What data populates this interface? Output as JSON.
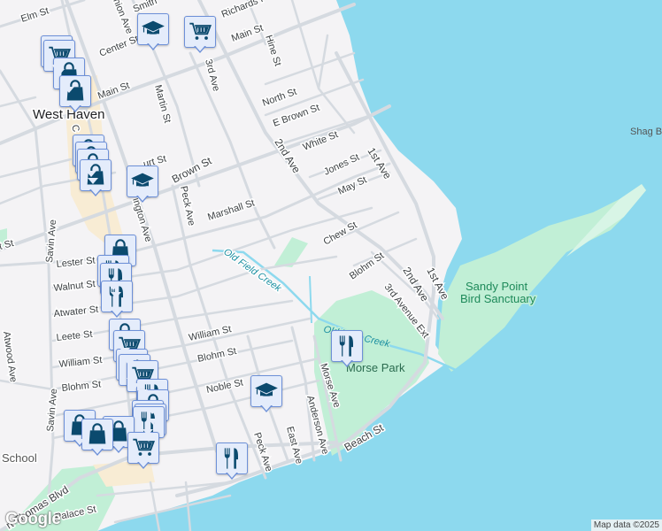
{
  "map": {
    "town": "West Haven",
    "park_morse": "Morse Park",
    "park_sandy_1": "Sandy Point",
    "park_sandy_2": "Bird Sanctuary",
    "shag": "Shag B",
    "creek1": "Old Field Creek",
    "creek2": "Old Field Creek",
    "school": "School",
    "streets": {
      "elm": "Elm St",
      "main1": "Main St",
      "main2": "Main St",
      "center": "Center St",
      "smith": "Smith",
      "richards": "Richards P",
      "union": "nion Ave",
      "hine": "Hine St",
      "north": "North St",
      "ebrown": "E Brown St",
      "white": "White St",
      "jones": "Jones St",
      "may": "May St",
      "chew": "Chew St",
      "blohm_e": "Blohm St",
      "second1": "2nd Ave",
      "second2": "2nd Ave",
      "first": "1st Ave",
      "third": "3rd Ave",
      "third_ext": "3rd Avenue Ext",
      "martin": "Martin St",
      "brown": "Brown St",
      "court": "urt St",
      "washington": "ington Ave",
      "peck1": "Peck Ave",
      "marshall": "Marshall St",
      "savin1": "Savin Ave",
      "savin2": "Savin Ave",
      "west": "t St",
      "lester": "Lester St",
      "walnut": "Walnut St",
      "atwater": "Atwater St",
      "leete": "Leete St",
      "william1": "William St",
      "william2": "William St",
      "blohm1": "Blohm St",
      "blohm2": "Blohm St",
      "noble": "Noble St",
      "atwood": "Atwood Ave",
      "peck2": "Peck Ave",
      "east": "East Ave",
      "anderson": "Anderson Ave",
      "morse": "Morse Ave",
      "beach": "Beach St",
      "thomas": "rt Thomas Blvd",
      "palace": "Palace St",
      "campbell": "C"
    }
  },
  "markers": [
    {
      "icon": "graduation-cap"
    },
    {
      "icon": "shopping-cart"
    },
    {
      "icon": "shopping-cart"
    },
    {
      "icon": "shopping-cart"
    },
    {
      "icon": "shopping-bag"
    },
    {
      "icon": "shopping-bag"
    },
    {
      "icon": "shopping-bag"
    },
    {
      "icon": "shopping-bag"
    },
    {
      "icon": "shopping-bag"
    },
    {
      "icon": "shopping-bag"
    },
    {
      "icon": "graduation-cap"
    },
    {
      "icon": "shopping-bag"
    },
    {
      "icon": "restaurant"
    },
    {
      "icon": "restaurant"
    },
    {
      "icon": "restaurant"
    },
    {
      "icon": "shopping-bag"
    },
    {
      "icon": "shopping-cart"
    },
    {
      "icon": "restaurant"
    },
    {
      "icon": "restaurant"
    },
    {
      "icon": "shopping-cart"
    },
    {
      "icon": "restaurant"
    },
    {
      "icon": "shopping-bag"
    },
    {
      "icon": "restaurant"
    },
    {
      "icon": "restaurant"
    },
    {
      "icon": "restaurant"
    },
    {
      "icon": "shopping-bag"
    },
    {
      "icon": "shopping-bag"
    },
    {
      "icon": "shopping-bag"
    },
    {
      "icon": "shopping-cart"
    },
    {
      "icon": "graduation-cap"
    },
    {
      "icon": "restaurant"
    },
    {
      "icon": "restaurant"
    }
  ],
  "footer": {
    "google": "Google",
    "attribution": "Map data ©2025"
  },
  "colors": {
    "water": "#8dd9ee",
    "land": "#f4f3f5",
    "park": "#c1efd6",
    "road": "#d5dae0",
    "marker_bg": "#e4ecfb",
    "marker_border": "#6d90d8",
    "icon": "#0b4a6e"
  }
}
